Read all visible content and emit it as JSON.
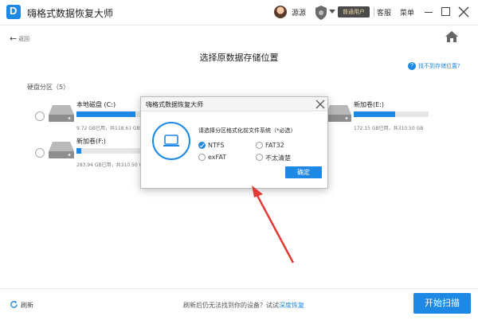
{
  "app": {
    "logo": "D",
    "title": "嗨格式数据恢复大师"
  },
  "header": {
    "user_name": "源源",
    "badge": "普通用户",
    "service": "客服",
    "menu": "菜单"
  },
  "nav": {
    "back_label": "返回"
  },
  "page": {
    "title": "选择原数据存储位置",
    "help_link": "找不到存储位置?",
    "section_label": "硬盘分区（5）"
  },
  "drives": [
    {
      "name": "本地磁盘 (C:)",
      "info": "9.72 GB已用，共118.61 GB",
      "used": 0.92
    },
    {
      "name": "新加卷(E:)",
      "info": "172.15 GB已用，共310.50 GB",
      "used": 0.55
    },
    {
      "name": "新加卷(F:)",
      "info": "283.94 GB已用，共310.50 GB",
      "used": 0.08
    }
  ],
  "dialog": {
    "title": "嗨格式数据恢复大师",
    "prompt": "请选择分区格式化前文件系统（*必选）",
    "options": [
      {
        "label": "NTFS",
        "checked": true
      },
      {
        "label": "FAT32",
        "checked": false
      },
      {
        "label": "exFAT",
        "checked": false
      },
      {
        "label": "不太清楚",
        "checked": false
      }
    ],
    "confirm": "确定"
  },
  "footer": {
    "refresh": "刷新",
    "text": "刷新后仍无法找到你的设备？试试",
    "link": "深度恢复",
    "start": "开始扫描"
  },
  "colors": {
    "accent": "#1e88e5",
    "arrow": "#e53935"
  }
}
